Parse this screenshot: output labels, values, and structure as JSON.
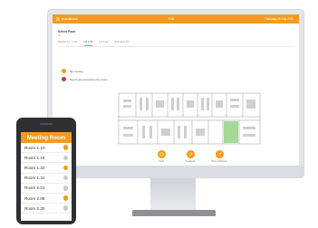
{
  "colors": {
    "accent": "#f59a1c",
    "busy": "#c8334c",
    "free": "#c9cacb"
  },
  "desktop": {
    "topbar": {
      "logo": "condeco",
      "center": "9:58",
      "right": "Thursday 09 July 2020"
    },
    "title": "Select Floor",
    "subtitle": "31",
    "tabs": [
      {
        "label": "Mayfair lot + 1.02",
        "active": false
      },
      {
        "label": "HT 1.02",
        "active": true
      },
      {
        "label": "HT 1.03",
        "active": false
      },
      {
        "label": "Schedule 03",
        "active": false
      }
    ],
    "legend": [
      {
        "label": "My meeting",
        "color": "orange"
      },
      {
        "label": "Rooms are occupied in the movie",
        "color": "red"
      }
    ],
    "actions": [
      {
        "label": "Clear",
        "icon": "clock-icon"
      },
      {
        "label": "Feedback",
        "icon": "refresh-icon"
      },
      {
        "label": "Show & Register",
        "icon": "arrow-icon"
      }
    ]
  },
  "phone": {
    "title": "Meeting Room",
    "rooms": [
      {
        "name": "Room 1.10",
        "status": "occupied"
      },
      {
        "name": "Room 1.16",
        "status": "available"
      },
      {
        "name": "Room 1.22",
        "status": "occupied"
      },
      {
        "name": "Room 1.31",
        "status": "available"
      },
      {
        "name": "Room 2.01",
        "status": "available"
      },
      {
        "name": "Room 2.08",
        "status": "occupied"
      },
      {
        "name": "Room 2.20",
        "status": "available"
      }
    ]
  }
}
